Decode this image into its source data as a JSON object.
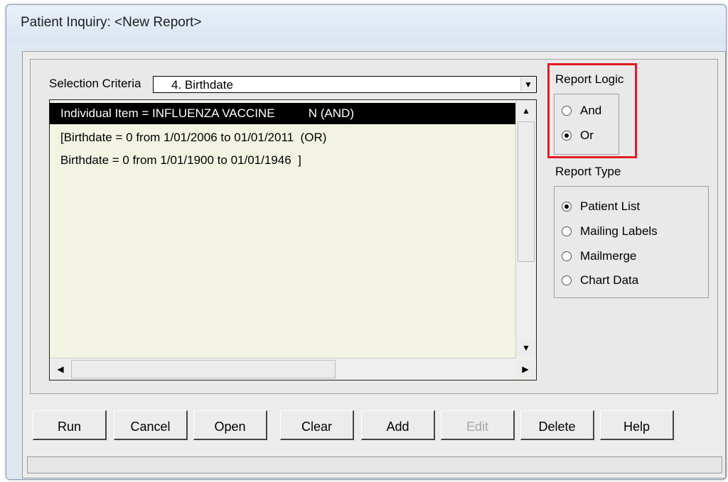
{
  "window": {
    "title": "Patient Inquiry: <New Report>"
  },
  "selection": {
    "label": "Selection Criteria",
    "value": "4. Birthdate"
  },
  "criteria_list": [
    "Individual Item = INFLUENZA VACCINE          N (AND)",
    "[Birthdate = 0 from 1/01/2006 to 01/01/2011  (OR)",
    "Birthdate = 0 from 1/01/1900 to 01/01/1946  ]"
  ],
  "report_logic": {
    "label": "Report Logic",
    "options": [
      "And",
      "Or"
    ],
    "selected": "Or"
  },
  "report_type": {
    "label": "Report Type",
    "options": [
      "Patient List",
      "Mailing Labels",
      "Mailmerge",
      "Chart Data"
    ],
    "selected": "Patient List"
  },
  "buttons": {
    "run": "Run",
    "cancel": "Cancel",
    "open": "Open",
    "clear": "Clear",
    "add": "Add",
    "edit": "Edit",
    "delete": "Delete",
    "help": "Help"
  },
  "colors": {
    "highlight": "#e31b23",
    "selection_bg": "#000000",
    "list_bg": "#f3f3e4"
  }
}
